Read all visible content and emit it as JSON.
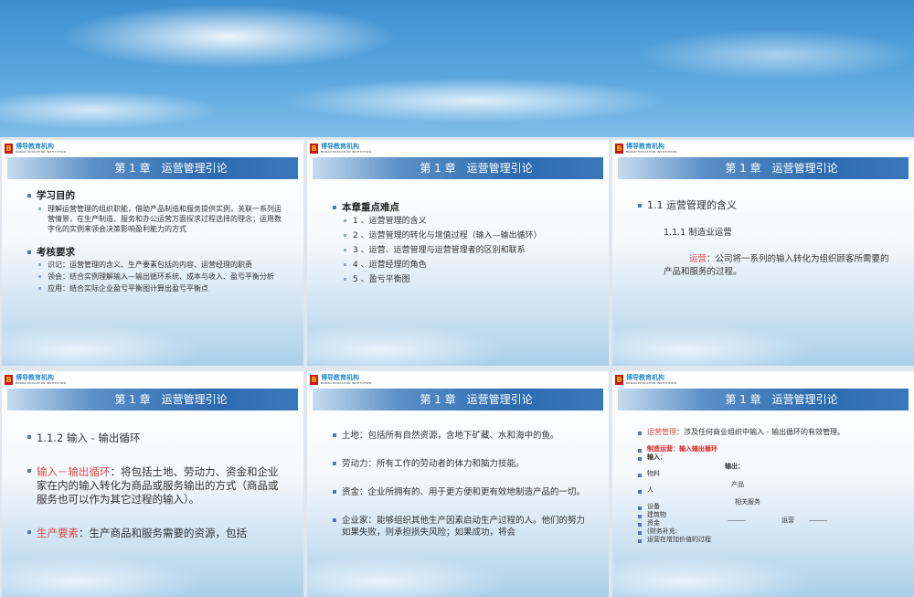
{
  "logo": {
    "name": "博导教育机构",
    "sub": "BODAO EDUCATION INSTITUTION"
  },
  "slide_title": "第 1 章　运营管理引论",
  "slides": [
    {
      "heading1": "学习目的",
      "item1": "理解运营管理的组织职能，借助产品制造和服务提供实例，关联一系列运营情景，在生产制造、服务和办公运营方面探求过程选择的理念；运用数字化的实例来领会决策影响盈利能力的方式",
      "heading2": "考核要求",
      "items": [
        "识记：运营管理的含义、生产要素包括的内容、运营经理的职责",
        "领会：结合实例理解输入—输出循环系统、成本与收入、盈亏平衡分析",
        "应用：结合实际企业盈亏平衡图计算出盈亏平衡点"
      ]
    },
    {
      "heading": "本章重点难点",
      "items": [
        "1 、运营管理的含义",
        "2 、运营管理的转化与增值过程（输入—输出循环）",
        "3 、运营、运营管理与运营管理者的区别和联系",
        "4 、运营经理的角色",
        "5 、盈亏平衡图"
      ]
    },
    {
      "heading": "1.1  运营管理的含义",
      "sub": "1.1.1  制造业运营",
      "term": "运营",
      "def": "：公司将一系列的输入转化为组织顾客所需要的产品和服务的过程。"
    },
    {
      "heading": "1.1.2  输入 - 输出循环",
      "term1": "输入－输出循环",
      "def1": "：将包括土地、劳动力、资金和企业家在内的输入转化为商品或服务输出的方式（商品或服务也可以作为其它过程的输入）。",
      "term2": "生产要素",
      "def2": "：生产商品和服务需要的资源，包括"
    },
    {
      "items": [
        "土地：包括所有自然资源，含地下矿藏、水和海中的鱼。",
        "劳动力：所有工作的劳动者的体力和脑力技能。",
        "资金：企业所拥有的、用于更方便和更有效地制造产品的一切。",
        "企业家：能够组织其他生产因素启动生产过程的人。他们的努力如果失败，则承担损失风险；如果成功，将会"
      ]
    },
    {
      "term": "运营管理",
      "def": "：涉及任何商业组织中输入 - 输出循环的有效管理。",
      "red_line": "制造运营：输入输出循环",
      "input_label": "输入：",
      "output_label": "输出：",
      "inputs": [
        "物料",
        "人",
        "设备",
        "建筑物",
        "资金",
        "(财务补充:",
        "运营在增加价值的过程"
      ],
      "outputs": [
        "产品",
        "相关服务"
      ],
      "dashes": "------------------------",
      "process": "运营"
    }
  ]
}
